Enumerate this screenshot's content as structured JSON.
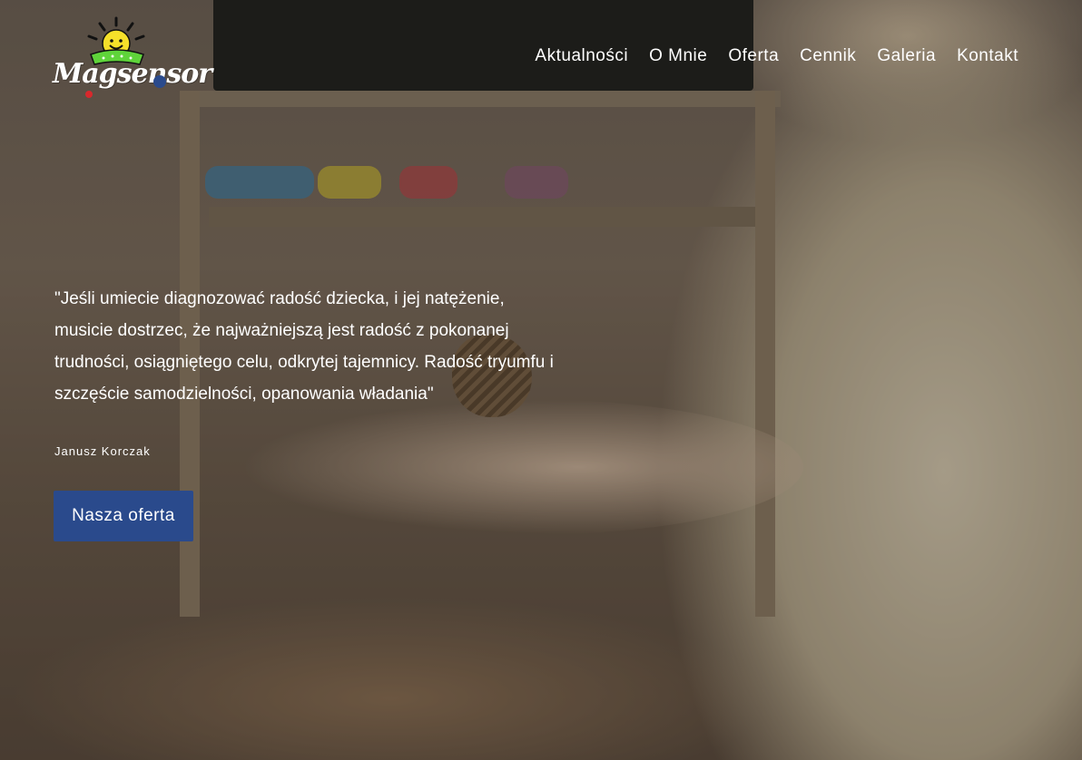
{
  "brand": {
    "name": "Magsensor",
    "logo_text": "Magsensor",
    "sun_color": "#f6e02a",
    "leaf_color": "#5fd43a",
    "dot_red": "#d8282c",
    "dot_blue": "#2a4a8c"
  },
  "nav": {
    "items": [
      {
        "label": "Aktualności"
      },
      {
        "label": "O Mnie"
      },
      {
        "label": "Oferta"
      },
      {
        "label": "Cennik"
      },
      {
        "label": "Galeria"
      },
      {
        "label": "Kontakt"
      }
    ]
  },
  "hero": {
    "quote": "\"Jeśli umiecie diagnozować radość dziecka, i jej natężenie, musicie dostrzec, że najważniejszą jest radość z pokonanej trudności, osiągniętego celu, odkrytej tajemnicy. Radość tryumfu i szczęście samodzielności, opanowania władania\"",
    "author": "Janusz Korczak",
    "cta_label": "Nasza oferta",
    "cta_color": "#2a4a8c"
  }
}
